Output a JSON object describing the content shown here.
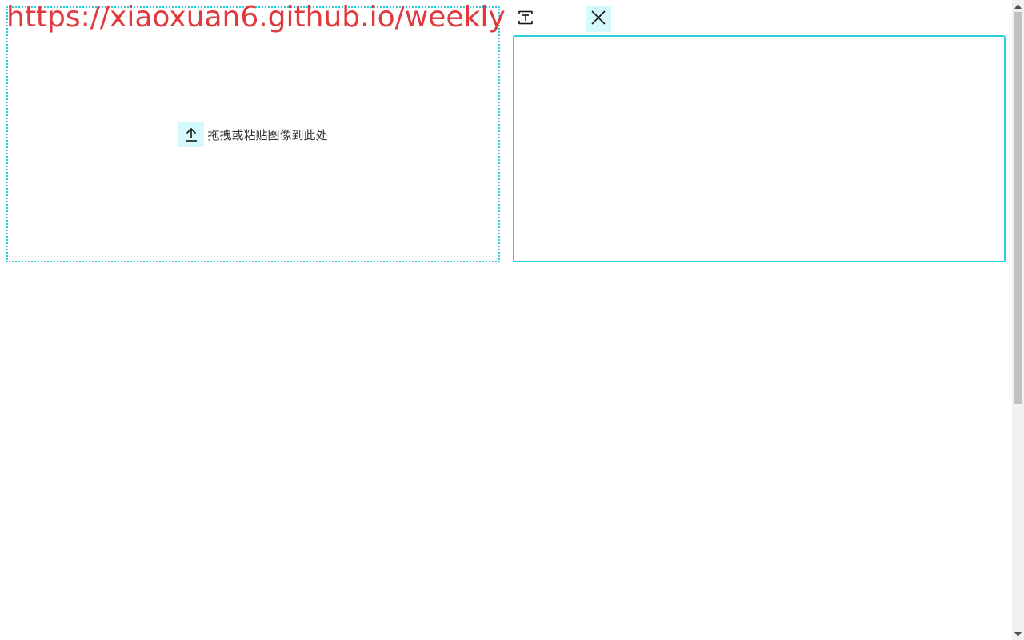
{
  "watermark": {
    "text": "https://xiaoxuan6.github.io/weekly",
    "color": "#e03a3e"
  },
  "dropzone": {
    "label": "拖拽或粘贴图像到此处",
    "icon": "upload-arrow-icon",
    "border_color": "#2bcfe0"
  },
  "toolbar": {
    "text_icon": "text-format-icon",
    "close_icon": "close-icon"
  },
  "output": {
    "value": "",
    "border_color": "#2bcfe0"
  },
  "colors": {
    "accent": "#2bcfe0",
    "accent_bg": "#d5f9fd",
    "watermark": "#e03a3e"
  }
}
